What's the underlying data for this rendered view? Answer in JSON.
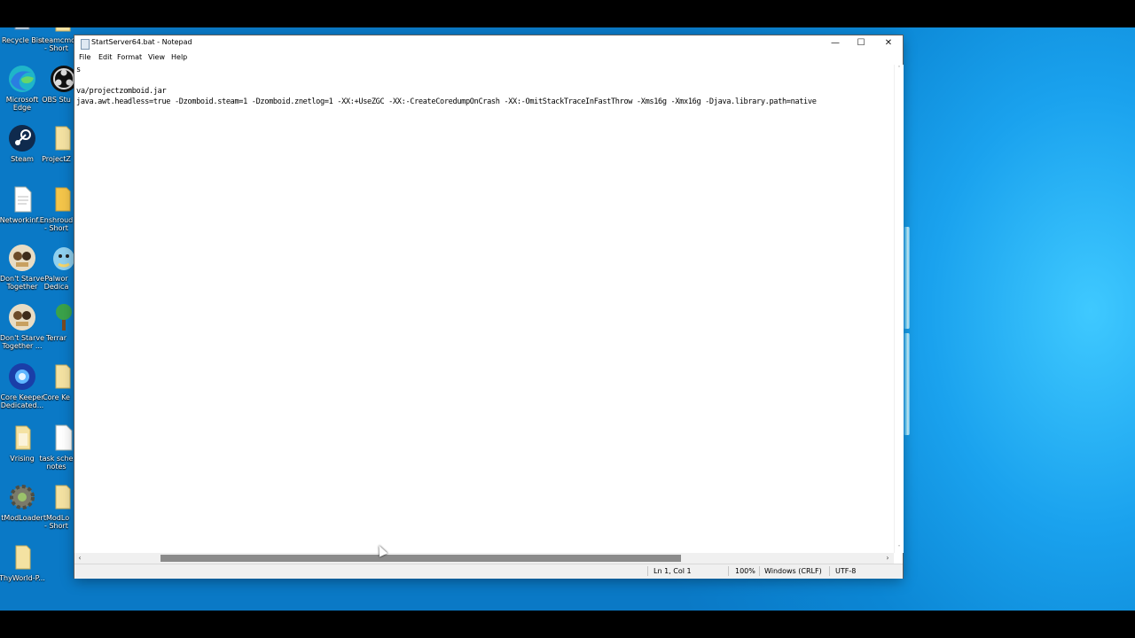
{
  "desktop": {
    "icons": [
      {
        "label": "Recycle Bin",
        "icon": "recycle-bin-icon"
      },
      {
        "label": "steamcmd\n- Short",
        "icon": "shortcut-icon"
      },
      {
        "label": "Microsoft\nEdge",
        "icon": "edge-icon"
      },
      {
        "label": "OBS Stu",
        "icon": "obs-icon"
      },
      {
        "label": "Steam",
        "icon": "steam-icon"
      },
      {
        "label": "ProjectZ",
        "icon": "folder-icon"
      },
      {
        "label": "Networkinf...",
        "icon": "file-icon"
      },
      {
        "label": "Enshroud\n- Short",
        "icon": "folder-icon"
      },
      {
        "label": "Don't Starve\nTogether",
        "icon": "dont-starve-icon"
      },
      {
        "label": "Palwor\nDedica",
        "icon": "palworld-icon"
      },
      {
        "label": "Don't Starve\nTogether ...",
        "icon": "dont-starve-icon"
      },
      {
        "label": "Terrar",
        "icon": "terraria-icon"
      },
      {
        "label": "Core Keeper\nDedicated...",
        "icon": "core-keeper-icon"
      },
      {
        "label": "Core Ke",
        "icon": "folder-icon"
      },
      {
        "label": "Vrising",
        "icon": "folder-icon"
      },
      {
        "label": "task sche\nnotes",
        "icon": "file-icon"
      },
      {
        "label": "tModLoader",
        "icon": "tmodloader-icon"
      },
      {
        "label": "tModLo\n- Short",
        "icon": "folder-icon"
      },
      {
        "label": "ThyWorld-P...",
        "icon": "folder-icon"
      }
    ]
  },
  "notepad": {
    "title": "StartServer64.bat - Notepad",
    "controls": {
      "minimize": "—",
      "maximize": "☐",
      "close": "✕"
    },
    "menu": [
      "File",
      "Edit",
      "Format",
      "View",
      "Help"
    ],
    "lines": [
      "s",
      "",
      "va/projectzomboid.jar",
      "java.awt.headless=true -Dzomboid.steam=1 -Dzomboid.znetlog=1 -XX:+UseZGC -XX:-CreateCoredumpOnCrash -XX:-OmitStackTraceInFastThrow -Xms16g -Xmx16g -Djava.library.path=native"
    ],
    "scroll_arrows": {
      "left": "‹",
      "right": "›",
      "up": "˄",
      "down": "˅"
    },
    "status": {
      "position": "Ln 1, Col 1",
      "zoom": "100%",
      "line_ending": "Windows (CRLF)",
      "encoding": "UTF-8"
    }
  }
}
